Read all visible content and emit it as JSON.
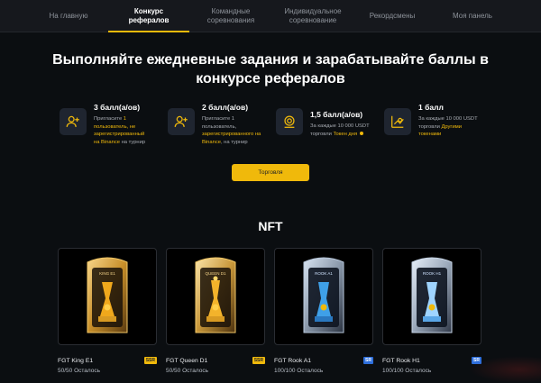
{
  "nav": {
    "items": [
      {
        "label": "На главную",
        "active": false
      },
      {
        "label": "Конкурс рефералов",
        "active": true
      },
      {
        "label": "Командные соревнования",
        "active": false
      },
      {
        "label": "Индивидуальное соревнование",
        "active": false
      },
      {
        "label": "Рекордсмены",
        "active": false
      },
      {
        "label": "Моя панель",
        "active": false
      }
    ]
  },
  "hero": {
    "title": "Выполняйте ежедневные задания и зарабатывайте баллы в конкурсе рефералов"
  },
  "tasks": [
    {
      "points": "3 балл(а/ов)",
      "desc_pre": "Пригласите ",
      "desc_hl1": "1 пользователь, не зарегистрированный на Binance",
      "desc_post": " на турнир",
      "icon": "user-plus-icon"
    },
    {
      "points": "2 балл(а/ов)",
      "desc_pre": "Пригласите 1 пользователь, ",
      "desc_hl1": "зарегистрированного на Binance",
      "desc_post": ", на турнир",
      "icon": "user-plus-icon"
    },
    {
      "points": "1,5 балл(а/ов)",
      "desc_pre": "За каждые 10 000 USDT торговли ",
      "desc_hl1": "Токен дня",
      "desc_post": "",
      "icon": "coin-trade-icon"
    },
    {
      "points": "1 балл",
      "desc_pre": "За каждые 10 000 USDT торговли ",
      "desc_hl1": "Другими токенами",
      "desc_post": "",
      "icon": "chart-trade-icon"
    }
  ],
  "trade_button": {
    "label": "Торговля"
  },
  "nft": {
    "title": "NFT",
    "cards": [
      {
        "name": "FGT King E1",
        "badge": "SSR",
        "stock": "50/50 Осталось",
        "card_label": "KING E1",
        "theme": "gold"
      },
      {
        "name": "FGT Queen D1",
        "badge": "SSR",
        "stock": "50/50 Осталось",
        "card_label": "QUEEN D1",
        "theme": "gold"
      },
      {
        "name": "FGT Rook A1",
        "badge": "SR",
        "stock": "100/100 Осталось",
        "card_label": "ROOK A1",
        "theme": "blue"
      },
      {
        "name": "FGT Rook H1",
        "badge": "SR",
        "stock": "100/100 Осталось",
        "card_label": "ROOK H1",
        "theme": "blue"
      }
    ]
  },
  "colors": {
    "accent": "#f0b90b",
    "background": "#0b0e11",
    "nav_bg": "#16181d",
    "sr_badge": "#2e6fdc"
  }
}
